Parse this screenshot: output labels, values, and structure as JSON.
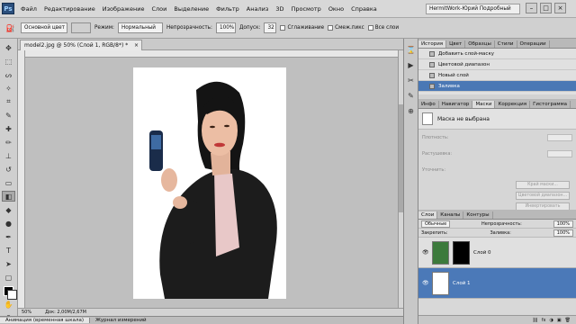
{
  "menubar": {
    "logo": "Ps",
    "items": [
      "Файл",
      "Редактирование",
      "Изображение",
      "Слои",
      "Выделение",
      "Фильтр",
      "Анализ",
      "3D",
      "Просмотр",
      "Окно",
      "Справка"
    ],
    "zoom": "50%",
    "workspace_name": "HermitWork-Юрий Подробный",
    "window_controls": [
      "–",
      "□",
      "×"
    ]
  },
  "optionsbar": {
    "preset": "Основной цвет",
    "mode_label": "Режим:",
    "mode_value": "Нормальный",
    "opacity_label": "Непрозрачность:",
    "opacity_value": "100%",
    "tolerance_label": "Допуск:",
    "tolerance_value": "32",
    "antialias": "Сглаживание",
    "contiguous": "Смеж.пикс",
    "all_layers": "Все слои"
  },
  "document": {
    "tab_title": "model2.jpg @ 50% (Слой 1, RGB/8*) *",
    "tab_close": "×",
    "status_zoom": "50%",
    "status_doc": "Док: 2,00M/2,67M"
  },
  "bottom_tabs": [
    "Анимация (временная шкала)",
    "Журнал измерений"
  ],
  "history": {
    "tabs": [
      "История",
      "Цвет",
      "Образцы",
      "Стили",
      "Операции"
    ],
    "items": [
      {
        "label": "Добавить слой-маску",
        "selected": false
      },
      {
        "label": "Цветовой диапазон",
        "selected": false
      },
      {
        "label": "Новый слой",
        "selected": false
      },
      {
        "label": "Заливка",
        "selected": true
      }
    ]
  },
  "masks": {
    "tabs": [
      "Инфо",
      "Навигатор",
      "Маски",
      "Коррекция",
      "Гистограмма"
    ],
    "title": "Маска не выбрана",
    "density_label": "Плотность:",
    "feather_label": "Растушевка:",
    "refine_label": "Уточнить:",
    "mask_edge_btn": "Край маски...",
    "color_range_btn": "Цветовой диапазон...",
    "invert_btn": "Инвертировать"
  },
  "layers": {
    "tabs": [
      "Слои",
      "Каналы",
      "Контуры"
    ],
    "blend_mode": "Обычные",
    "opacity_label": "Непрозрачность:",
    "opacity_value": "100%",
    "lock_label": "Закрепить:",
    "fill_label": "Заливка:",
    "fill_value": "100%",
    "items": [
      {
        "name": "Слой 0",
        "selected": false
      },
      {
        "name": "Слой 1",
        "selected": true
      }
    ]
  },
  "colors": {
    "selection": "#4a78b5",
    "canvas_bg": "#bfbfbf",
    "ps_blue": "#2c4f7c"
  }
}
